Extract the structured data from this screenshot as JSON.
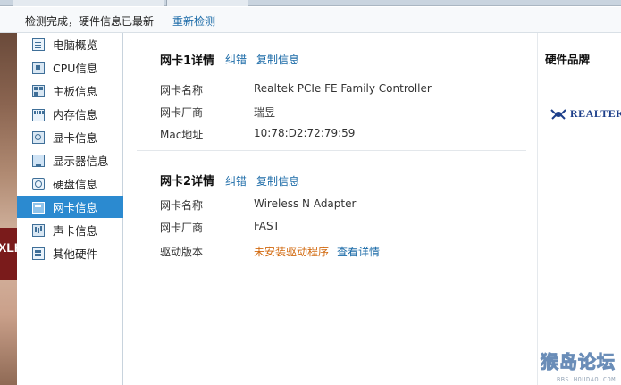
{
  "status": {
    "message": "检测完成，硬件信息已最新",
    "rescan_label": "重新检测"
  },
  "background_text": "XLK",
  "sidebar": {
    "items": [
      {
        "label": "电脑概览",
        "icon": "overview-icon"
      },
      {
        "label": "CPU信息",
        "icon": "cpu-icon"
      },
      {
        "label": "主板信息",
        "icon": "motherboard-icon"
      },
      {
        "label": "内存信息",
        "icon": "memory-icon"
      },
      {
        "label": "显卡信息",
        "icon": "graphics-card-icon"
      },
      {
        "label": "显示器信息",
        "icon": "monitor-icon"
      },
      {
        "label": "硬盘信息",
        "icon": "hard-disk-icon"
      },
      {
        "label": "网卡信息",
        "icon": "network-card-icon",
        "active": true
      },
      {
        "label": "声卡信息",
        "icon": "sound-card-icon"
      },
      {
        "label": "其他硬件",
        "icon": "other-hardware-icon"
      }
    ],
    "active_color": "#2b8ad0"
  },
  "nic1": {
    "title": "网卡1详情",
    "correct_label": "纠错",
    "copy_label": "复制信息",
    "rows": [
      {
        "label": "网卡名称",
        "value": "Realtek PCIe FE Family Controller"
      },
      {
        "label": "网卡厂商",
        "value": "瑞昱"
      },
      {
        "label": "Mac地址",
        "value": "10:78:D2:72:79:59"
      }
    ]
  },
  "nic2": {
    "title": "网卡2详情",
    "correct_label": "纠错",
    "copy_label": "复制信息",
    "rows": [
      {
        "label": "网卡名称",
        "value": "Wireless N Adapter"
      },
      {
        "label": "网卡厂商",
        "value": "FAST"
      },
      {
        "label": "驱动版本",
        "value": "未安装驱动程序"
      }
    ],
    "driver_details_label": "查看详情"
  },
  "brand": {
    "title": "硬件品牌",
    "logo_text": "REALTEK"
  },
  "watermark": {
    "main": "猴岛论坛",
    "sub": "BBS.HOUDAO.COM"
  },
  "colors": {
    "link": "#1a6aa7",
    "warning": "#d26a10",
    "brand_logo": "#1d3f8a"
  }
}
